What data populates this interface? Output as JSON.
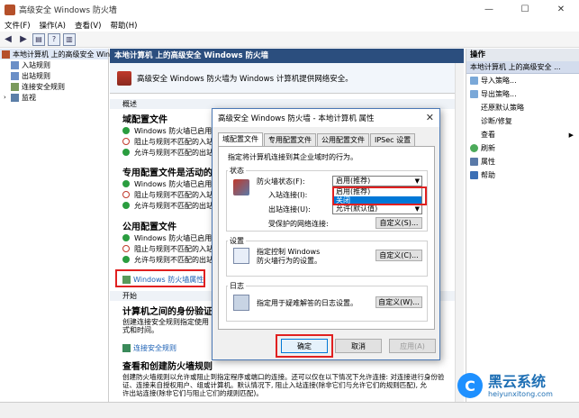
{
  "window": {
    "title": "高级安全 Windows 防火墙",
    "controls": [
      "—",
      "☐",
      "✕"
    ]
  },
  "menu": [
    "文件(F)",
    "操作(A)",
    "查看(V)",
    "帮助(H)"
  ],
  "tree": [
    {
      "label": "本地计算机 上的高级安全 Wind",
      "selected": true
    },
    {
      "label": "入站规则"
    },
    {
      "label": "出站规则"
    },
    {
      "label": "连接安全规则"
    },
    {
      "label": "监视"
    }
  ],
  "center": {
    "header": "本地计算机 上的高级安全 Windows 防火墙",
    "intro": "高级安全 Windows 防火墙为 Windows 计算机提供网络安全。",
    "overview_label": "概述",
    "domain_profile": {
      "title": "域配置文件",
      "lines": [
        "Windows 防火墙已启用。",
        "阻止与规则不匹配的入站连",
        "允许与规则不匹配的出站连"
      ]
    },
    "private_profile": {
      "title": "专用配置文件是活动的",
      "lines": [
        "Windows 防火墙已启用。",
        "阻止与规则不匹配的入站连",
        "允许与规则不匹配的出站连"
      ]
    },
    "public_profile": {
      "title": "公用配置文件",
      "lines": [
        "Windows 防火墙已启用。",
        "阻止与规则不匹配的入站连",
        "允许与规则不匹配的出站连"
      ]
    },
    "properties_link": "Windows 防火墙属性",
    "start_label": "开始",
    "auth_title": "计算机之间的身份验证",
    "auth_text": [
      "创建连接安全规则指定使用",
      "式和时间。"
    ],
    "csr_link": "连接安全规则",
    "view_title": "查看和创建防火墙规则",
    "view_text": [
      "创建防火墙规则以允许或阻止到指定程序或端口的连接。还可以仅在以下情况下允许连接: 对连接进行身份验",
      "证、连接来自授权用户、组或计算机。默认情况下, 阻止入站连接(除非它们与允许它们的规则匹配), 允",
      "许出站连接(除非它们与阻止它们的规则匹配)。"
    ]
  },
  "actions": {
    "header": "操作",
    "sub": "本地计算机 上的高级安全 ...",
    "items": [
      "导入策略...",
      "导出策略...",
      "还原默认策略",
      "诊断/修复",
      "查看",
      "刷新",
      "属性",
      "帮助"
    ]
  },
  "dialog": {
    "title": "高级安全 Windows 防火墙 - 本地计算机 属性",
    "tabs": [
      "域配置文件",
      "专用配置文件",
      "公用配置文件",
      "IPSec 设置"
    ],
    "desc": "指定将计算机连接到其企业域时的行为。",
    "state_label": "状态",
    "fw_state_label": "防火墙状态(F):",
    "fw_state_value": "启用(推荐)",
    "dd_option_1": "启用(推荐)",
    "dd_option_2": "关闭",
    "inbound_label": "入站连接(I):",
    "outbound_label": "出站连接(U):",
    "outbound_value": "允许(默认值)",
    "protected_label": "受保护的网络连接:",
    "customize": "自定义(S)...",
    "settings_label": "设置",
    "settings_text": "指定控制 Windows 防火墙行为的设置。",
    "settings_btn": "自定义(C)...",
    "log_label": "日志",
    "log_text": "指定用于疑难解答的日志设置。",
    "log_btn": "自定义(W)...",
    "ok": "确定",
    "cancel": "取消",
    "apply": "应用(A)"
  },
  "watermark": {
    "logo": "C",
    "cn": "黑云系统",
    "en": "heiyunxitong.com"
  }
}
